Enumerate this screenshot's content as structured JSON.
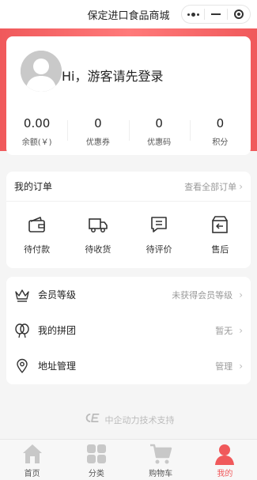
{
  "app": {
    "title": "保定进口食品商城"
  },
  "profile": {
    "greeting": "Hi，游客请先登录"
  },
  "stats": [
    {
      "value": "0.00",
      "label": "余额(￥)"
    },
    {
      "value": "0",
      "label": "优惠券"
    },
    {
      "value": "0",
      "label": "优惠码"
    },
    {
      "value": "0",
      "label": "积分"
    }
  ],
  "orders": {
    "title": "我的订单",
    "view_all": "查看全部订单",
    "items": [
      {
        "label": "待付款",
        "icon": "wallet-icon"
      },
      {
        "label": "待收货",
        "icon": "truck-icon"
      },
      {
        "label": "待评价",
        "icon": "comment-icon"
      },
      {
        "label": "售后",
        "icon": "return-box-icon"
      }
    ]
  },
  "menu": [
    {
      "label": "会员等级",
      "value": "未获得会员等级",
      "icon": "crown-icon"
    },
    {
      "label": "我的拼团",
      "value": "暂无",
      "icon": "group-balloon-icon"
    },
    {
      "label": "地址管理",
      "value": "管理",
      "icon": "location-pin-icon"
    }
  ],
  "support": {
    "text": "中企动力技术支持"
  },
  "tabbar": [
    {
      "label": "首页",
      "icon": "home-icon",
      "active": false
    },
    {
      "label": "分类",
      "icon": "category-grid-icon",
      "active": false
    },
    {
      "label": "购物车",
      "icon": "cart-icon",
      "active": false
    },
    {
      "label": "我的",
      "icon": "user-icon",
      "active": true
    }
  ],
  "colors": {
    "accent": "#f0595b",
    "tab_inactive_icon": "#c8c8c8",
    "avatar": "#c9c9c9"
  }
}
